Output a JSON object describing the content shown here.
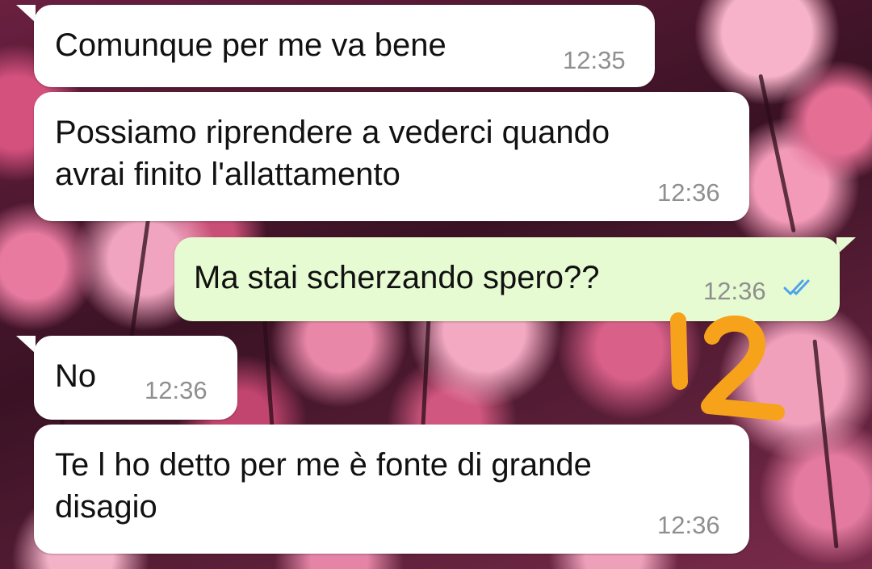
{
  "chat": {
    "messages": [
      {
        "direction": "incoming",
        "text": "Comunque per me va bene",
        "time": "12:35"
      },
      {
        "direction": "incoming",
        "text": "Possiamo riprendere a vederci quando\navrai finito l'allattamento",
        "time": "12:36"
      },
      {
        "direction": "outgoing",
        "text": "Ma stai scherzando spero??",
        "time": "12:36",
        "status_icon": "double-check-read-icon"
      },
      {
        "direction": "incoming",
        "text": "No",
        "time": "12:36"
      },
      {
        "direction": "incoming",
        "text": "Te l ho detto per me è fonte di grande\ndisagio",
        "time": "12:36"
      }
    ]
  },
  "annotation": {
    "handwritten_text": "12",
    "color": "#f7a21b"
  },
  "colors": {
    "incoming_bubble": "#ffffff",
    "outgoing_bubble": "#e7fbd2",
    "timestamp": "#8f8f8f",
    "read_ticks": "#4fa3e8"
  }
}
